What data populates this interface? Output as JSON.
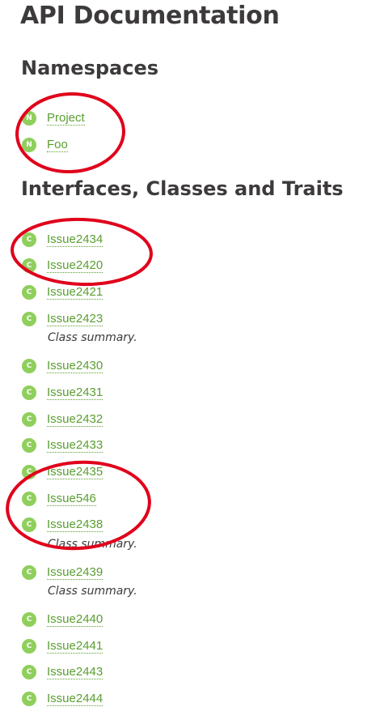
{
  "title": "API Documentation",
  "namespaces_heading": "Namespaces",
  "namespaces": [
    {
      "badge": "N",
      "name": "Project"
    },
    {
      "badge": "N",
      "name": "Foo"
    }
  ],
  "classes_heading": "Interfaces, Classes and Traits",
  "classes": [
    {
      "badge": "C",
      "name": "Issue2434"
    },
    {
      "badge": "C",
      "name": "Issue2420"
    },
    {
      "badge": "C",
      "name": "Issue2421"
    },
    {
      "badge": "C",
      "name": "Issue2423",
      "summary": "Class summary."
    },
    {
      "badge": "C",
      "name": "Issue2430"
    },
    {
      "badge": "C",
      "name": "Issue2431"
    },
    {
      "badge": "C",
      "name": "Issue2432"
    },
    {
      "badge": "C",
      "name": "Issue2433"
    },
    {
      "badge": "C",
      "name": "Issue2435"
    },
    {
      "badge": "C",
      "name": "Issue546"
    },
    {
      "badge": "C",
      "name": "Issue2438",
      "summary": "Class summary."
    },
    {
      "badge": "C",
      "name": "Issue2439",
      "summary": "Class summary."
    },
    {
      "badge": "C",
      "name": "Issue2440"
    },
    {
      "badge": "C",
      "name": "Issue2441"
    },
    {
      "badge": "C",
      "name": "Issue2443"
    },
    {
      "badge": "C",
      "name": "Issue2444"
    }
  ],
  "colors": {
    "badge": "#8fcf5c",
    "link": "#5a9e31",
    "annotation": "#e0001b",
    "heading": "#3d3a3b"
  }
}
